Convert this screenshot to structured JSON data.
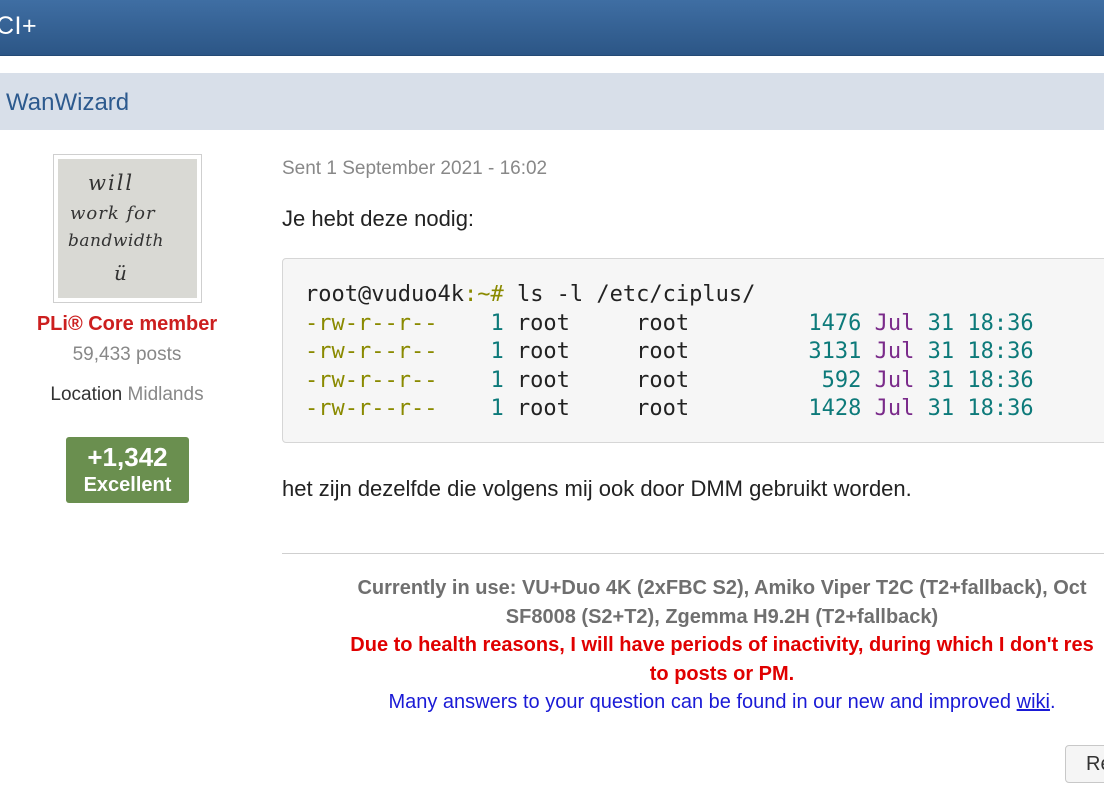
{
  "topbar": {
    "title": "CI+"
  },
  "author": {
    "name": "WanWizard"
  },
  "user": {
    "avatar_text": [
      "will",
      "work for",
      "bandwidth",
      "ü"
    ],
    "role": "PLi® Core member",
    "posts": "59,433 posts",
    "location_label": "Location",
    "location_value": "Midlands",
    "reputation": "+1,342",
    "reputation_label": "Excellent"
  },
  "post": {
    "date": "Sent 1 September 2021 - 16:02",
    "line1": "Je hebt deze nodig:",
    "code": {
      "prompt_user": "root@vuduo4k",
      "prompt_sep": ":~#",
      "command": " ls -l /etc/ciplus/",
      "rows": [
        {
          "perms": "-rw-r--r--",
          "links": "1",
          "owner": "root",
          "group": "root",
          "size": "1476",
          "month": "Jul",
          "day": "31",
          "time": "18:36"
        },
        {
          "perms": "-rw-r--r--",
          "links": "1",
          "owner": "root",
          "group": "root",
          "size": "3131",
          "month": "Jul",
          "day": "31",
          "time": "18:36"
        },
        {
          "perms": "-rw-r--r--",
          "links": "1",
          "owner": "root",
          "group": "root",
          "size": "592",
          "month": "Jul",
          "day": "31",
          "time": "18:36"
        },
        {
          "perms": "-rw-r--r--",
          "links": "1",
          "owner": "root",
          "group": "root",
          "size": "1428",
          "month": "Jul",
          "day": "31",
          "time": "18:36"
        }
      ]
    },
    "line2": "het zijn dezelfde die volgens mij ook door DMM gebruikt worden."
  },
  "signature": {
    "current_line1": "Currently in use: VU+Duo 4K (2xFBC S2), Amiko Viper T2C (T2+fallback), Oct",
    "current_line2": "SF8008 (S2+T2), Zgemma H9.2H (T2+fallback)",
    "health_line1": "Due to health reasons, I will have periods of inactivity, during which I don't res",
    "health_line2": "to posts or PM.",
    "wiki_text": "Many answers to your question can be found in our new and improved ",
    "wiki_link": "wiki",
    "wiki_end": "."
  },
  "actions": {
    "reply_label": "Re"
  },
  "colors": {
    "topbar": "#2c5686",
    "author_bar": "#d8dfe9",
    "role": "#cc1f1f",
    "reputation": "#6a8f4f",
    "health": "#e00000",
    "link": "#1a1ad6"
  }
}
